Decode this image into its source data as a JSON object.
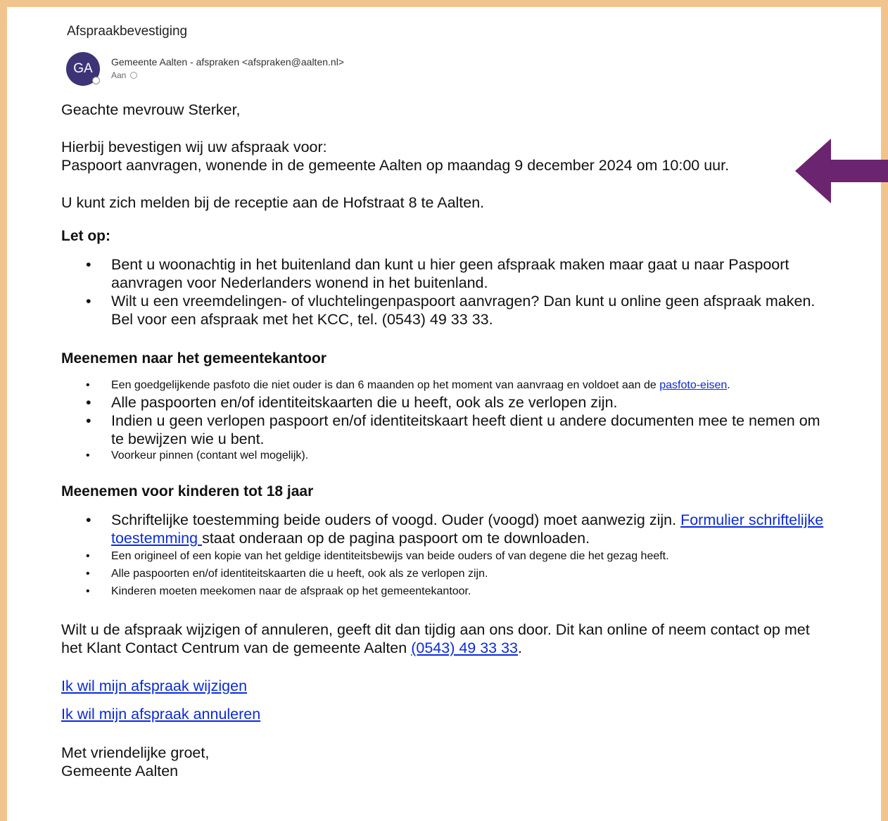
{
  "email": {
    "subject": "Afspraakbevestiging",
    "avatar_initials": "GA",
    "sender": "Gemeente Aalten - afspraken <afspraken@aalten.nl>",
    "to_label": "Aan"
  },
  "body": {
    "greeting": "Geachte mevrouw Sterker,",
    "confirm_line1": "Hierbij bevestigen wij uw afspraak voor:",
    "confirm_line2": "Paspoort aanvragen, wonende in de gemeente Aalten op maandag 9 december 2024 om 10:00 uur.",
    "report_line": "U kunt zich melden bij de receptie aan de Hofstraat 8 te Aalten.",
    "letop_heading": "Let op:",
    "letop_items": [
      "Bent u woonachtig in het buitenland dan kunt u hier geen afspraak maken maar gaat u naar Paspoort aanvragen voor Nederlanders wonend in het buitenland.",
      "Wilt u een vreemdelingen- of vluchtelingenpaspoort aanvragen? Dan kunt u online geen afspraak maken. Bel voor een afspraak met het KCC, tel. (0543) 49 33 33."
    ],
    "bring_heading": "Meenemen naar het gemeentekantoor",
    "bring_item1_text": "Een goedgelijkende pasfoto die niet ouder is dan 6 maanden op het moment van aanvraag en voldoet aan de ",
    "bring_item1_link": "pasfoto-eisen",
    "bring_item1_end": ".",
    "bring_item2": "Alle paspoorten en/of identiteitskaarten die u heeft, ook als ze verlopen zijn.",
    "bring_item3": "Indien u geen verlopen paspoort en/of identiteitskaart heeft dient u andere documenten mee te nemen om te bewijzen wie u bent.",
    "bring_item4": "Voorkeur pinnen (contant wel mogelijk).",
    "kids_heading": "Meenemen voor kinderen tot 18 jaar",
    "kids_item1_text": "Schriftelijke toestemming beide ouders of voogd. Ouder (voogd) moet aanwezig zijn. ",
    "kids_item1_link": "Formulier schriftelijke toestemming ",
    "kids_item1_end": " staat onderaan op de pagina paspoort om te downloaden.",
    "kids_item2": "Een origineel of een kopie van het geldige identiteitsbewijs van beide ouders of van degene die het gezag heeft.",
    "kids_item3": "Alle paspoorten en/of identiteitskaarten die u heeft, ook als ze verlopen zijn.",
    "kids_item4": "Kinderen moeten meekomen naar de afspraak op het gemeentekantoor.",
    "change_text": "Wilt u de afspraak wijzigen of annuleren, geeft dit dan tijdig aan ons door. Dit kan online of neem contact op met het Klant Contact Centrum van de gemeente Aalten ",
    "change_phone": "(0543) 49 33 33",
    "change_end": ".",
    "link_change": "Ik wil mijn afspraak wijzigen",
    "link_cancel": "Ik wil mijn afspraak annuleren",
    "closing": "Met vriendelijke groet,",
    "signature": "Gemeente Aalten"
  },
  "colors": {
    "frame": "#f0c48c",
    "arrow": "#6b2470",
    "avatar": "#3d3478",
    "link": "#0b2bd6"
  }
}
